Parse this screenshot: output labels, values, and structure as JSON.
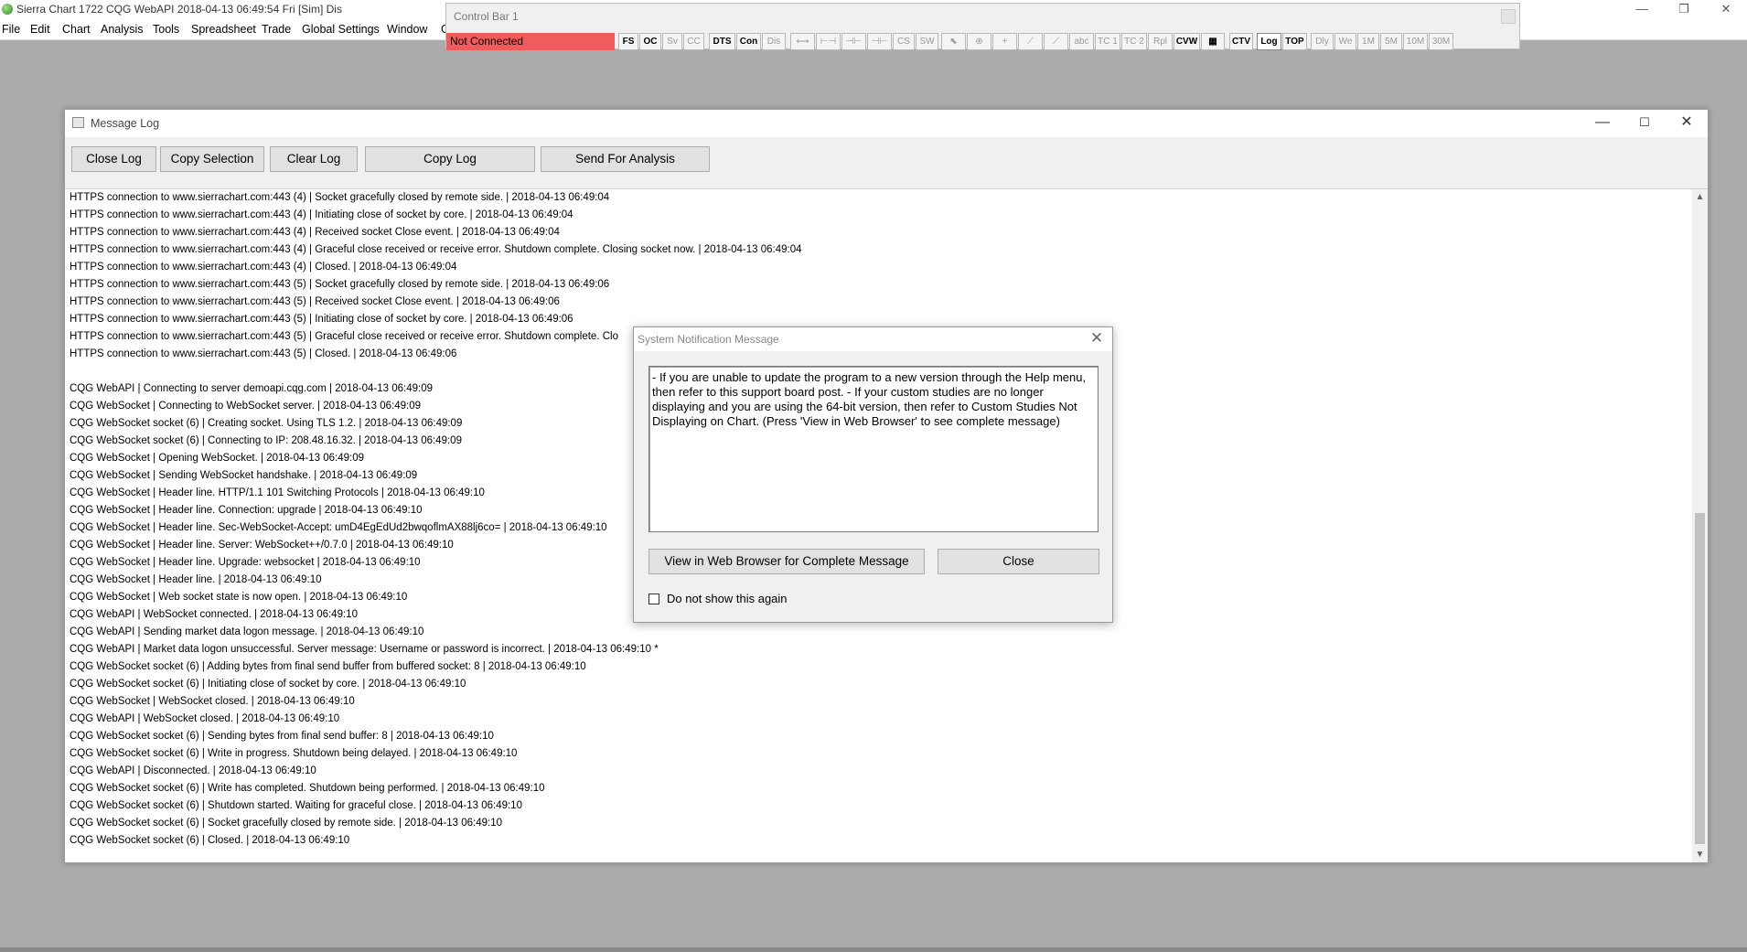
{
  "app": {
    "title": "Sierra Chart 1722 CQG WebAPI 2018-04-13  06:49:54 Fri [Sim]  Dis",
    "minimize_glyph": "—",
    "restore_glyph": "❐",
    "close_glyph": "✕"
  },
  "menu": [
    "File",
    "Edit",
    "Chart",
    "Analysis",
    "Tools",
    "Spreadsheet",
    "Trade",
    "Global Settings",
    "Window",
    "G"
  ],
  "control_bar": {
    "title": "Control Bar 1",
    "status": "Not Connected",
    "status_color": "#f05b5b",
    "buttons": [
      "FS",
      "OC",
      "Sv",
      "CC",
      "DTS",
      "Con",
      "Dis",
      "⟷",
      "⊢⊣",
      "⊣⊢",
      "⊣⊢",
      "CS",
      "SW",
      "⬉",
      "⊕",
      "+",
      "⟋",
      "⟋",
      "abc",
      "TC 1",
      "TC 2",
      "Rpl",
      "CVW",
      "▦",
      "CTV",
      "Log",
      "TOP",
      "Dly",
      "We",
      "1M",
      "5M",
      "10M",
      "30M"
    ]
  },
  "log_window": {
    "title": "Message Log",
    "buttons": {
      "close_log": "Close Log",
      "copy_selection": "Copy Selection",
      "clear_log": "Clear Log",
      "copy_log": "Copy Log",
      "send_for_analysis": "Send For Analysis"
    },
    "lines": [
      "HTTPS connection to www.sierrachart.com:443 (4) | Socket gracefully closed by remote side. | 2018-04-13  06:49:04",
      "HTTPS connection to www.sierrachart.com:443 (4) | Initiating close of socket by core. | 2018-04-13  06:49:04",
      "HTTPS connection to www.sierrachart.com:443 (4) | Received socket Close event. | 2018-04-13  06:49:04",
      "HTTPS connection to www.sierrachart.com:443 (4) | Graceful close received or receive error. Shutdown complete. Closing socket now. | 2018-04-13  06:49:04",
      "HTTPS connection to www.sierrachart.com:443 (4) | Closed. | 2018-04-13  06:49:04",
      "HTTPS connection to www.sierrachart.com:443 (5) | Socket gracefully closed by remote side. | 2018-04-13  06:49:06",
      "HTTPS connection to www.sierrachart.com:443 (5) | Received socket Close event. | 2018-04-13  06:49:06",
      "HTTPS connection to www.sierrachart.com:443 (5) | Initiating close of socket by core. | 2018-04-13  06:49:06",
      "HTTPS connection to www.sierrachart.com:443 (5) | Graceful close received or receive error. Shutdown complete. Clo",
      "HTTPS connection to www.sierrachart.com:443 (5) | Closed. | 2018-04-13  06:49:06",
      "",
      "CQG WebAPI | Connecting to server demoapi.cqg.com | 2018-04-13  06:49:09",
      "CQG WebSocket | Connecting to WebSocket server. | 2018-04-13  06:49:09",
      "CQG WebSocket socket (6) | Creating socket.  Using TLS 1.2. | 2018-04-13  06:49:09",
      "CQG WebSocket socket (6) | Connecting to IP: 208.48.16.32. | 2018-04-13  06:49:09",
      "CQG WebSocket | Opening WebSocket. | 2018-04-13  06:49:09",
      "CQG WebSocket | Sending WebSocket handshake. | 2018-04-13  06:49:09",
      "CQG WebSocket | Header line. HTTP/1.1 101 Switching Protocols | 2018-04-13  06:49:10",
      "CQG WebSocket | Header line. Connection: upgrade | 2018-04-13  06:49:10",
      "CQG WebSocket | Header line. Sec-WebSocket-Accept: umD4EgEdUd2bwqoflmAX88lj6co= | 2018-04-13  06:49:10",
      "CQG WebSocket | Header line. Server: WebSocket++/0.7.0 | 2018-04-13  06:49:10",
      "CQG WebSocket | Header line. Upgrade: websocket | 2018-04-13  06:49:10",
      "CQG WebSocket | Header line.  | 2018-04-13  06:49:10",
      "CQG WebSocket | Web socket state is now open. | 2018-04-13  06:49:10",
      "CQG WebAPI | WebSocket connected. | 2018-04-13  06:49:10",
      "CQG WebAPI | Sending market data logon message. | 2018-04-13  06:49:10",
      "CQG WebAPI | Market data logon unsuccessful. Server message: Username or password is incorrect. | 2018-04-13  06:49:10 *",
      "CQG WebSocket socket (6) | Adding bytes from final send buffer from buffered socket: 8 | 2018-04-13  06:49:10",
      "CQG WebSocket socket (6) | Initiating close of socket by core. | 2018-04-13  06:49:10",
      "CQG WebSocket | WebSocket closed. | 2018-04-13  06:49:10",
      "CQG WebAPI | WebSocket closed. | 2018-04-13  06:49:10",
      "CQG WebSocket socket (6) | Sending bytes from final send buffer: 8 | 2018-04-13  06:49:10",
      "CQG WebSocket socket (6) | Write in progress. Shutdown being delayed. | 2018-04-13  06:49:10",
      "CQG WebAPI | Disconnected. | 2018-04-13  06:49:10",
      "CQG WebSocket socket (6) | Write has completed.  Shutdown being performed. | 2018-04-13  06:49:10",
      "CQG WebSocket socket (6) | Shutdown started. Waiting for graceful close. | 2018-04-13  06:49:10",
      "CQG WebSocket socket (6) | Socket gracefully closed by remote side. | 2018-04-13  06:49:10",
      "CQG WebSocket socket (6) | Closed. | 2018-04-13  06:49:10"
    ]
  },
  "notification": {
    "title": "System Notification Message",
    "message": "- If you are unable to update the program to a new version through the Help menu, then refer to this support board post.  - If your custom studies are no longer displaying and you are using the 64-bit version, then refer to Custom Studies Not Displaying on Chart.  (Press 'View in Web Browser' to see complete message)",
    "view_button": "View in Web Browser for Complete Message",
    "close_button": "Close",
    "dont_show_label": "Do not show this again",
    "dont_show_checked": false
  }
}
